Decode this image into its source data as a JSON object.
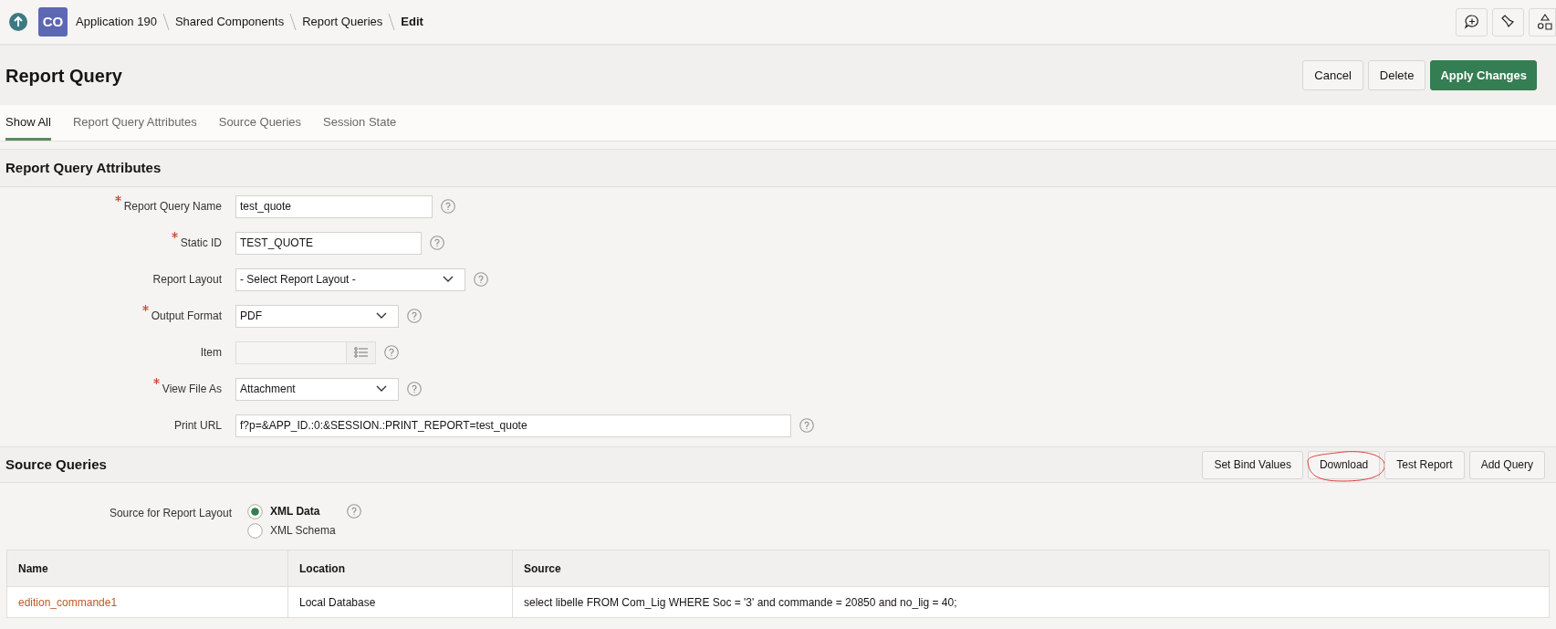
{
  "breadcrumb": {
    "app_badge": "CO",
    "items": [
      {
        "label": "Application 190",
        "current": false
      },
      {
        "label": "Shared Components",
        "current": false
      },
      {
        "label": "Report Queries",
        "current": false
      },
      {
        "label": "Edit",
        "current": true
      }
    ]
  },
  "page_title": "Report Query",
  "header_buttons": [
    {
      "label": "Cancel",
      "kind": "default"
    },
    {
      "label": "Delete",
      "kind": "default"
    },
    {
      "label": "Apply Changes",
      "kind": "primary"
    }
  ],
  "tabs": [
    {
      "label": "Show All",
      "selected": true
    },
    {
      "label": "Report Query Attributes",
      "selected": false
    },
    {
      "label": "Source Queries",
      "selected": false
    },
    {
      "label": "Session State",
      "selected": false
    }
  ],
  "attributes_section": {
    "title": "Report Query Attributes",
    "fields": [
      {
        "label": "Report Query Name",
        "required": true,
        "kind": "text",
        "value": "test_quote"
      },
      {
        "label": "Static ID",
        "required": true,
        "kind": "text",
        "value": "TEST_QUOTE"
      },
      {
        "label": "Report Layout",
        "required": false,
        "kind": "select",
        "value": "- Select Report Layout -"
      },
      {
        "label": "Output Format",
        "required": true,
        "kind": "select",
        "value": "PDF"
      },
      {
        "label": "Item",
        "required": false,
        "kind": "popup"
      },
      {
        "label": "View File As",
        "required": true,
        "kind": "select",
        "value": "Attachment"
      },
      {
        "label": "Print URL",
        "required": false,
        "kind": "text",
        "value": "f?p=&APP_ID.:0:&SESSION.:PRINT_REPORT=test_quote"
      }
    ]
  },
  "source_section": {
    "title": "Source Queries",
    "buttons": [
      {
        "label": "Set Bind Values",
        "circled": false
      },
      {
        "label": "Download",
        "circled": true
      },
      {
        "label": "Test Report",
        "circled": false
      },
      {
        "label": "Add Query",
        "circled": false
      }
    ],
    "layout_source": {
      "label": "Source for Report Layout",
      "options": [
        {
          "label": "XML Data",
          "selected": true
        },
        {
          "label": "XML Schema",
          "selected": false
        }
      ]
    },
    "table": {
      "columns": [
        "Name",
        "Location",
        "Source"
      ],
      "rows": [
        [
          "edition_commande1",
          "Local Database",
          "select libelle FROM Com_Lig WHERE Soc = '3' and commande = 20850 and no_lig = 40;"
        ]
      ]
    }
  }
}
